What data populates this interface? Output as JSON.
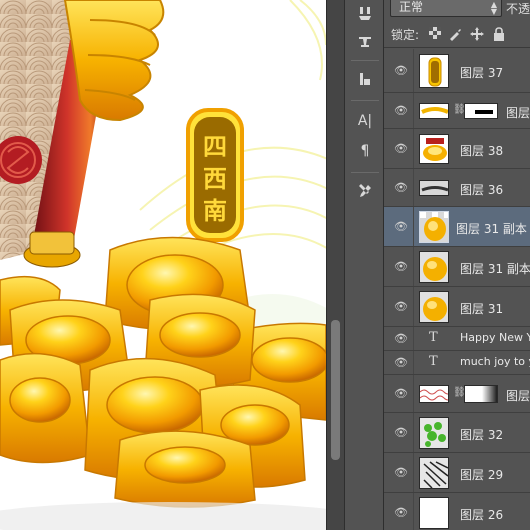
{
  "canvas": {
    "seal_text": "四西南",
    "description_colors": {
      "gold": "#f6b400",
      "scroll_red": "#b8201c",
      "seal_red": "#b31c22"
    }
  },
  "tools": [
    {
      "name": "brush-presets-icon"
    },
    {
      "name": "clone-source-icon"
    },
    {
      "name": "history-icon"
    },
    {
      "name": "character-icon",
      "glyph": "A|"
    },
    {
      "name": "paragraph-icon",
      "glyph": "¶"
    },
    {
      "name": "tool-presets-icon"
    }
  ],
  "layers_panel": {
    "blend_mode": "正常",
    "opacity_label": "不透",
    "lock_label": "锁定:",
    "layers": [
      {
        "label": "图层 37",
        "type": "image",
        "thumb": "seal"
      },
      {
        "label": "图层",
        "type": "masked",
        "thumb": "strip",
        "mask": "black-bar"
      },
      {
        "label": "图层 38",
        "type": "image",
        "thumb": "ingots-red"
      },
      {
        "label": "图层 36",
        "type": "image",
        "thumb": "line"
      },
      {
        "label": "图层 31 副本",
        "type": "image",
        "thumb": "ingot",
        "selected": true
      },
      {
        "label": "图层 31 副本",
        "type": "image",
        "thumb": "ingot"
      },
      {
        "label": "图层 31",
        "type": "image",
        "thumb": "ingot"
      },
      {
        "label": "Happy New Y",
        "type": "text"
      },
      {
        "label": "much joy to y",
        "type": "text"
      },
      {
        "label": "图层",
        "type": "masked",
        "thumb": "pattern",
        "mask": "gradient"
      },
      {
        "label": "图层 32",
        "type": "image",
        "thumb": "green"
      },
      {
        "label": "图层 29",
        "type": "image",
        "thumb": "dark-texture"
      },
      {
        "label": "图层 26",
        "type": "image",
        "thumb": "white"
      }
    ]
  }
}
